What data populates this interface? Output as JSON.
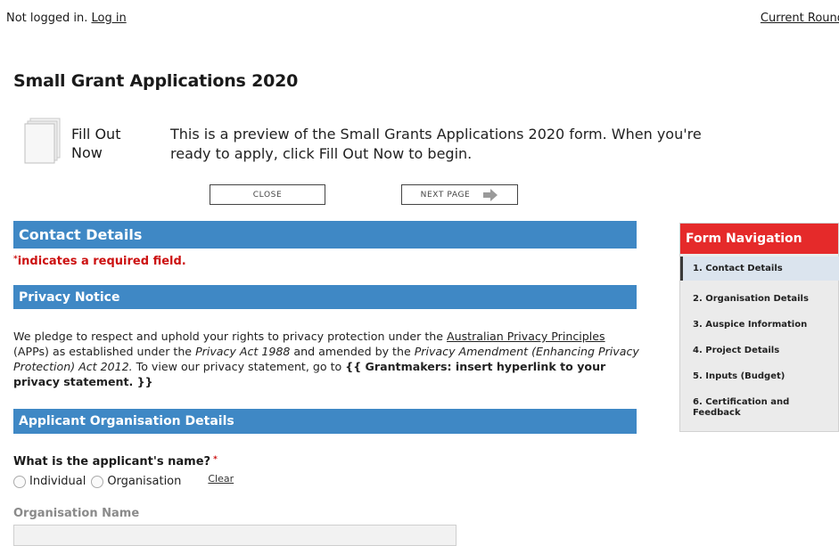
{
  "topbar": {
    "status_text": "Not logged in.",
    "login_link": "Log in",
    "current_round": "Current Round"
  },
  "form": {
    "title": "Small Grant Applications 2020",
    "fill_out_label": "Fill Out Now",
    "preview_text": "This is a preview of the Small Grants Applications 2020 form. When you're ready to apply, click Fill Out Now to begin.",
    "close_button": "CLOSE",
    "next_page_button": "NEXT PAGE"
  },
  "sections": {
    "contact_details": "Contact Details",
    "required_star": "*",
    "required_note": "indicates a required field.",
    "privacy_notice": "Privacy Notice",
    "applicant_org": "Applicant Organisation Details"
  },
  "privacy": {
    "p1": "We pledge to respect and uphold your rights to privacy protection under the ",
    "link": "Australian Privacy Principles",
    "p2": " (APPs) as established under the ",
    "act1": "Privacy Act 1988",
    "p3": " and amended by the ",
    "act2": "Privacy Amendment (Enhancing Privacy Protection) Act 2012.",
    "p4": " To view our privacy statement, go to ",
    "placeholder": "{{ Grantmakers: insert hyperlink to your privacy statement. }}"
  },
  "applicant": {
    "question": "What is the applicant's name?",
    "required_star": "*",
    "option_individual": "Individual",
    "option_organisation": "Organisation",
    "clear_link": "Clear",
    "org_name_label": "Organisation Name",
    "org_name_value": ""
  },
  "nav": {
    "header": "Form Navigation",
    "items": [
      "1. Contact Details",
      "2. Organisation Details",
      "3. Auspice Information",
      "4. Project Details",
      "5. Inputs (Budget)",
      "6. Certification and Feedback"
    ]
  },
  "colors": {
    "section_blue": "#3f88c5",
    "nav_red": "#e52a2a",
    "required_red": "#cc1111"
  },
  "icons": {
    "document": "document-stack-icon",
    "next_arrow": "arrow-right-icon"
  }
}
